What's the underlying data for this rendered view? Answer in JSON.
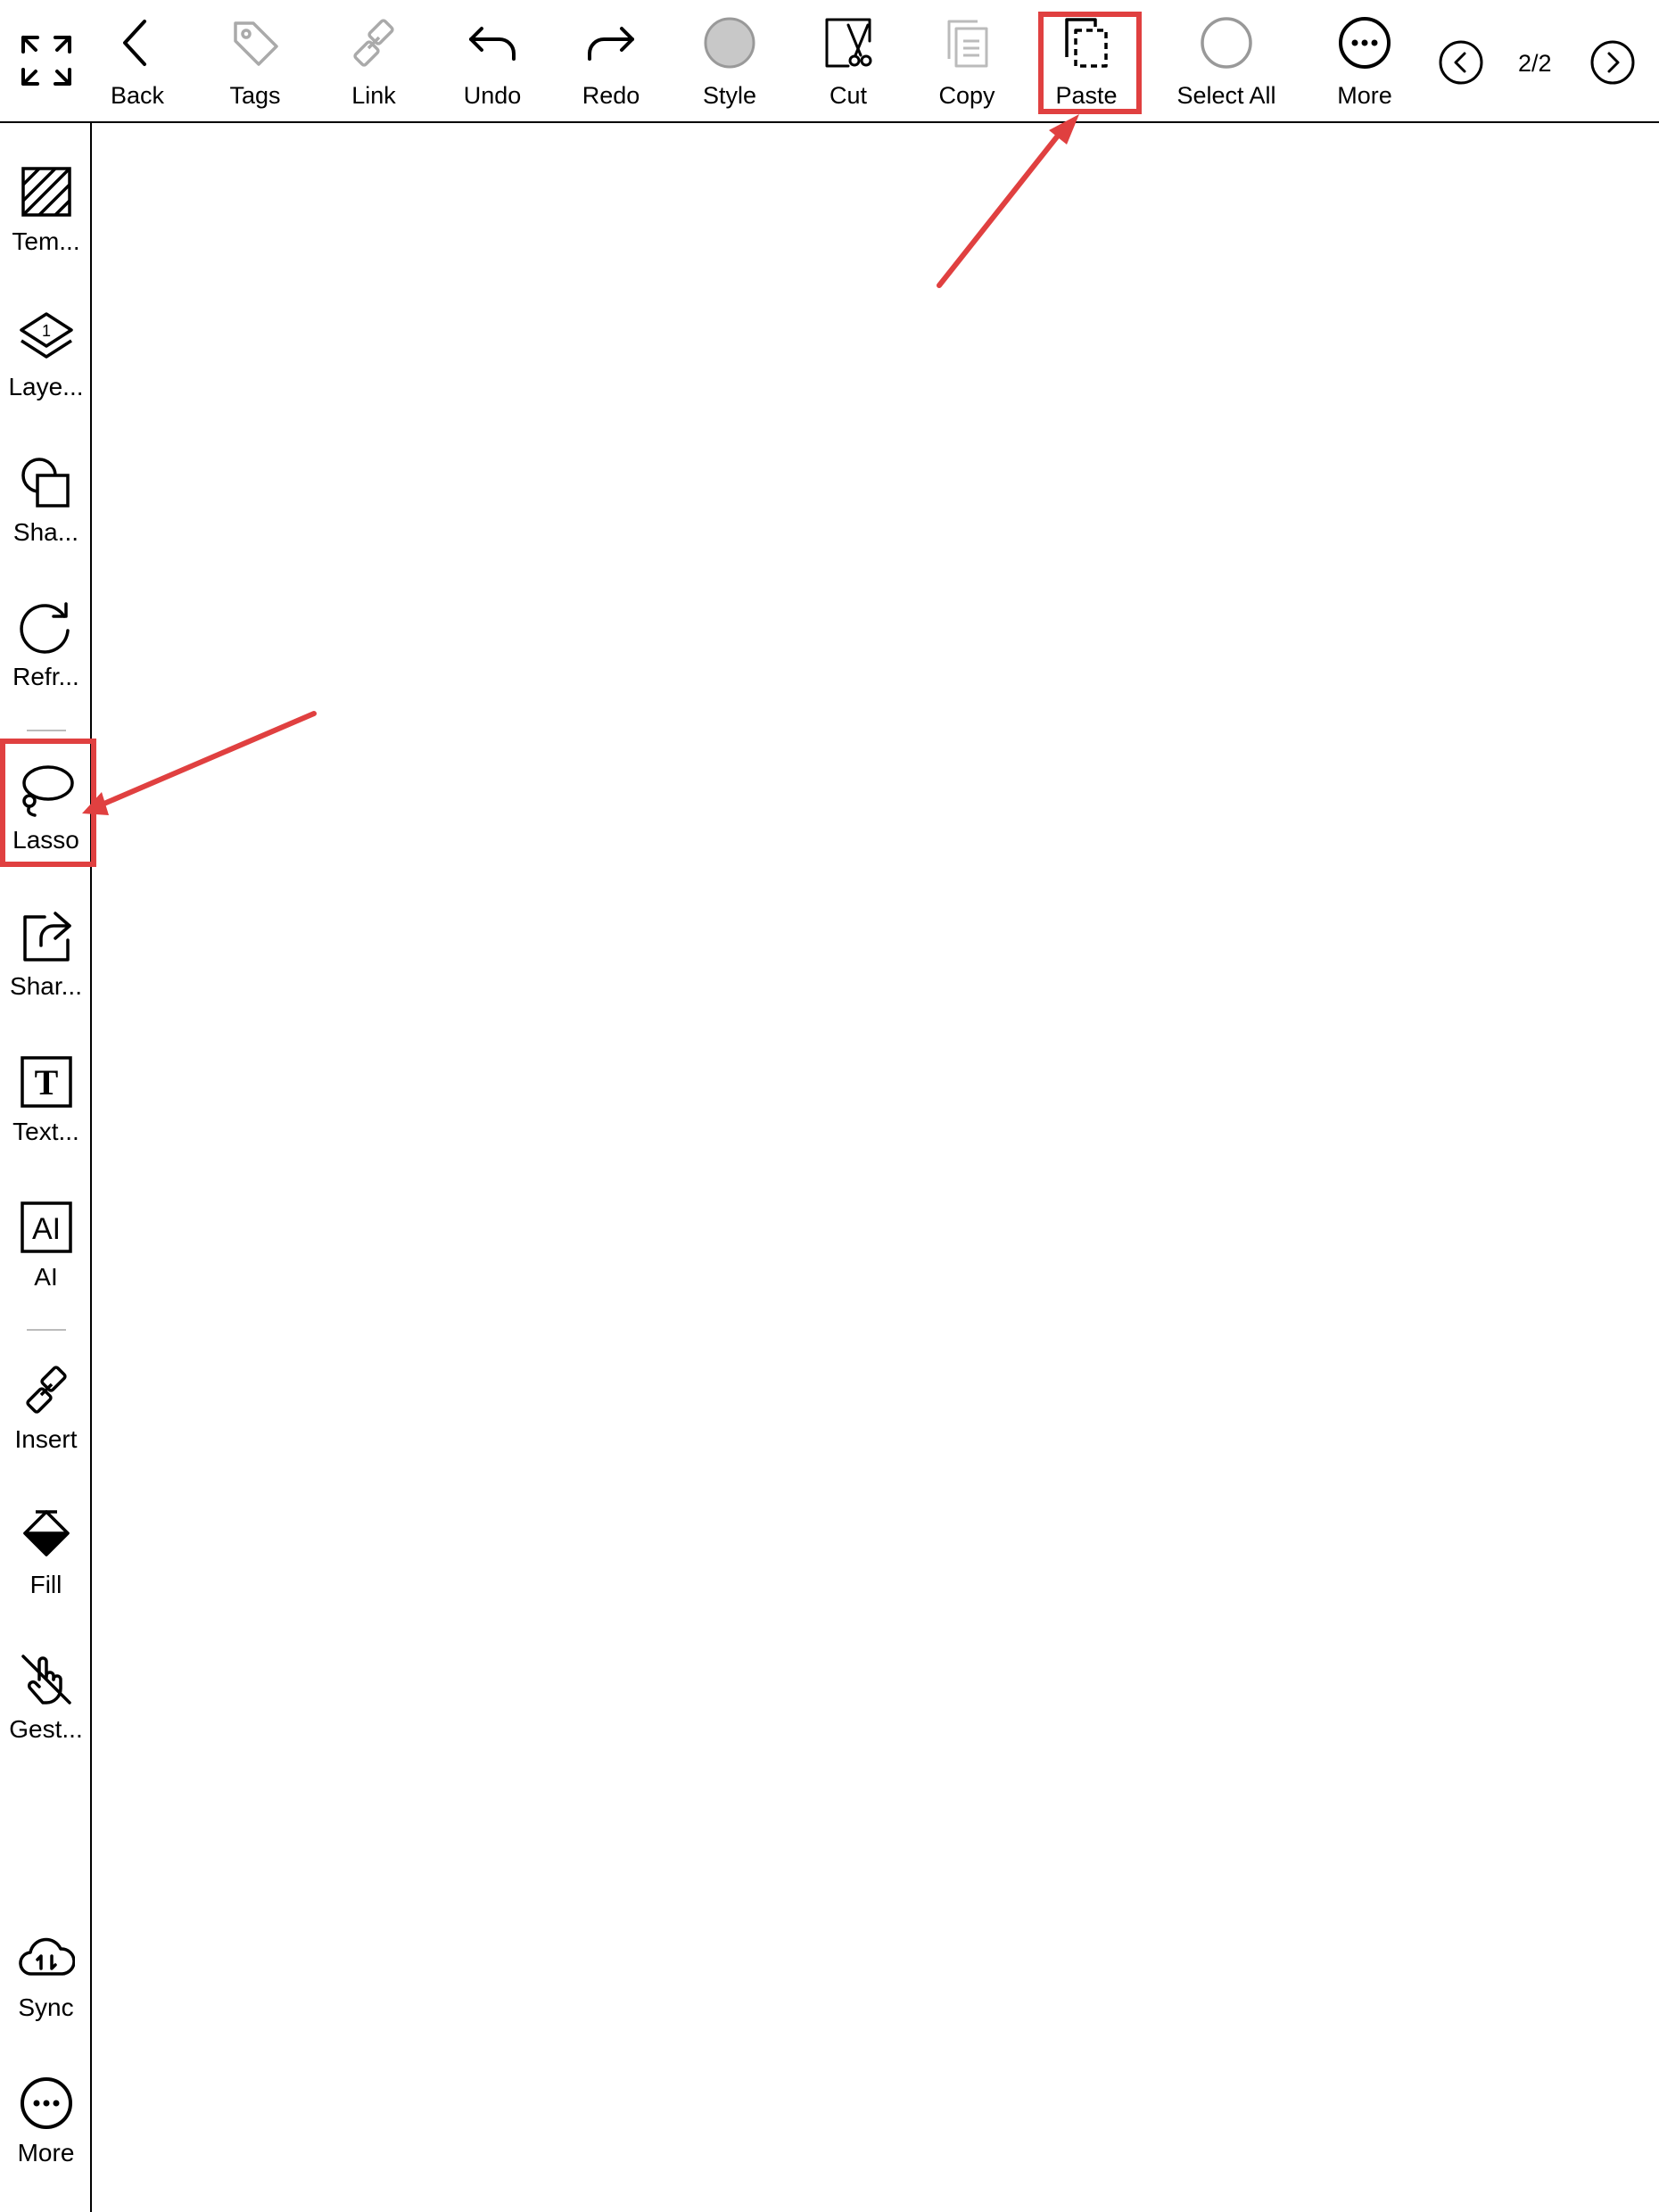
{
  "toolbar": {
    "items": [
      {
        "icon": "chevron-left-icon",
        "label": "Back"
      },
      {
        "icon": "tag-icon",
        "label": "Tags"
      },
      {
        "icon": "link-icon",
        "label": "Link"
      },
      {
        "icon": "undo-icon",
        "label": "Undo"
      },
      {
        "icon": "style-circle-icon",
        "label": "Style"
      },
      {
        "icon": "redo-icon",
        "label": "Redo"
      },
      {
        "icon": "scissors-icon",
        "label": "Cut"
      },
      {
        "icon": "copy-icon",
        "label": "Copy"
      },
      {
        "icon": "paste-icon",
        "label": "Paste"
      },
      {
        "icon": "select-all-circle-icon",
        "label": "Select All"
      },
      {
        "icon": "more-icon",
        "label": "More"
      }
    ],
    "page_indicator": "2/2"
  },
  "sidebar": {
    "items": [
      {
        "icon": "template-icon",
        "label": "Tem..."
      },
      {
        "icon": "layers-icon",
        "label": "Laye...",
        "badge": "1"
      },
      {
        "icon": "shapes-icon",
        "label": "Sha..."
      },
      {
        "icon": "refresh-icon",
        "label": "Refr..."
      },
      {
        "icon": "lasso-icon",
        "label": "Lasso"
      },
      {
        "icon": "share-icon",
        "label": "Shar..."
      },
      {
        "icon": "text-icon",
        "label": "Text...",
        "glyph": "T"
      },
      {
        "icon": "ai-icon",
        "label": "AI",
        "glyph": "AI"
      },
      {
        "icon": "insert-link-icon",
        "label": "Insert"
      },
      {
        "icon": "fill-icon",
        "label": "Fill"
      },
      {
        "icon": "gesture-icon",
        "label": "Gest..."
      },
      {
        "icon": "sync-cloud-icon",
        "label": "Sync"
      },
      {
        "icon": "more-icon",
        "label": "More"
      }
    ]
  },
  "colors": {
    "highlight": "#e04040",
    "disabled": "#aaaaaa",
    "style_fill": "#c8c8c8"
  }
}
